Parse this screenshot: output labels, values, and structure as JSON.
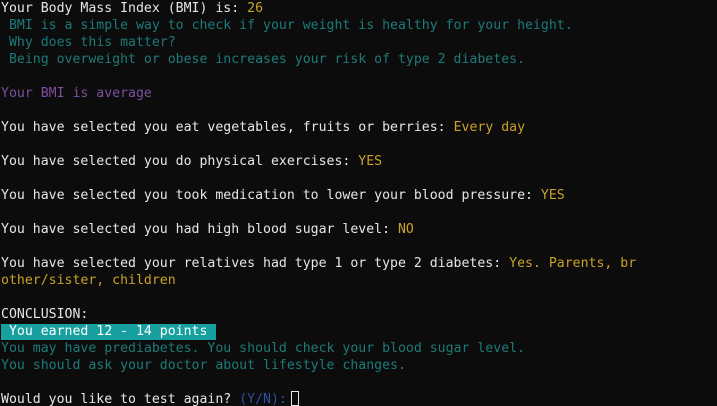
{
  "bmi": {
    "label": "Your Body Mass Index (BMI) is: ",
    "value": "26",
    "info": [
      " BMI is a simple way to check if your weight is healthy for your height.",
      " Why does this matter?",
      " Being overweight or obese increases your risk of type 2 diabetes."
    ],
    "verdict": "Your BMI is average"
  },
  "selections": [
    {
      "text": "You have selected you eat vegetables, fruits or berries: ",
      "answer": "Every day"
    },
    {
      "text": "You have selected you do physical exercises: ",
      "answer": "YES"
    },
    {
      "text": "You have selected you took medication to lower your blood pressure: ",
      "answer": "YES"
    },
    {
      "text": "You have selected you had high blood sugar level: ",
      "answer": "NO"
    },
    {
      "text": "You have selected your relatives had type 1 or type 2 diabetes: ",
      "answer": "Yes. Parents, br",
      "answer_wrap": "other/sister, children"
    }
  ],
  "conclusion": {
    "heading": "CONCLUSION:",
    "points": " You earned 12 - 14 points ",
    "advice": [
      "You may have prediabetes. You should check your blood sugar level.",
      "You should ask your doctor about lifestyle changes."
    ]
  },
  "prompt": {
    "question": "Would you like to test again? ",
    "options": "(Y/N):"
  },
  "colors": {
    "background": "#0c0c0c",
    "text": "#e6e6e6",
    "answer": "#c9a227",
    "info": "#1e7a7a",
    "verdict": "#7e4f9e",
    "points_bg": "#18a0a0",
    "prompt_options": "#2f4fa8"
  }
}
